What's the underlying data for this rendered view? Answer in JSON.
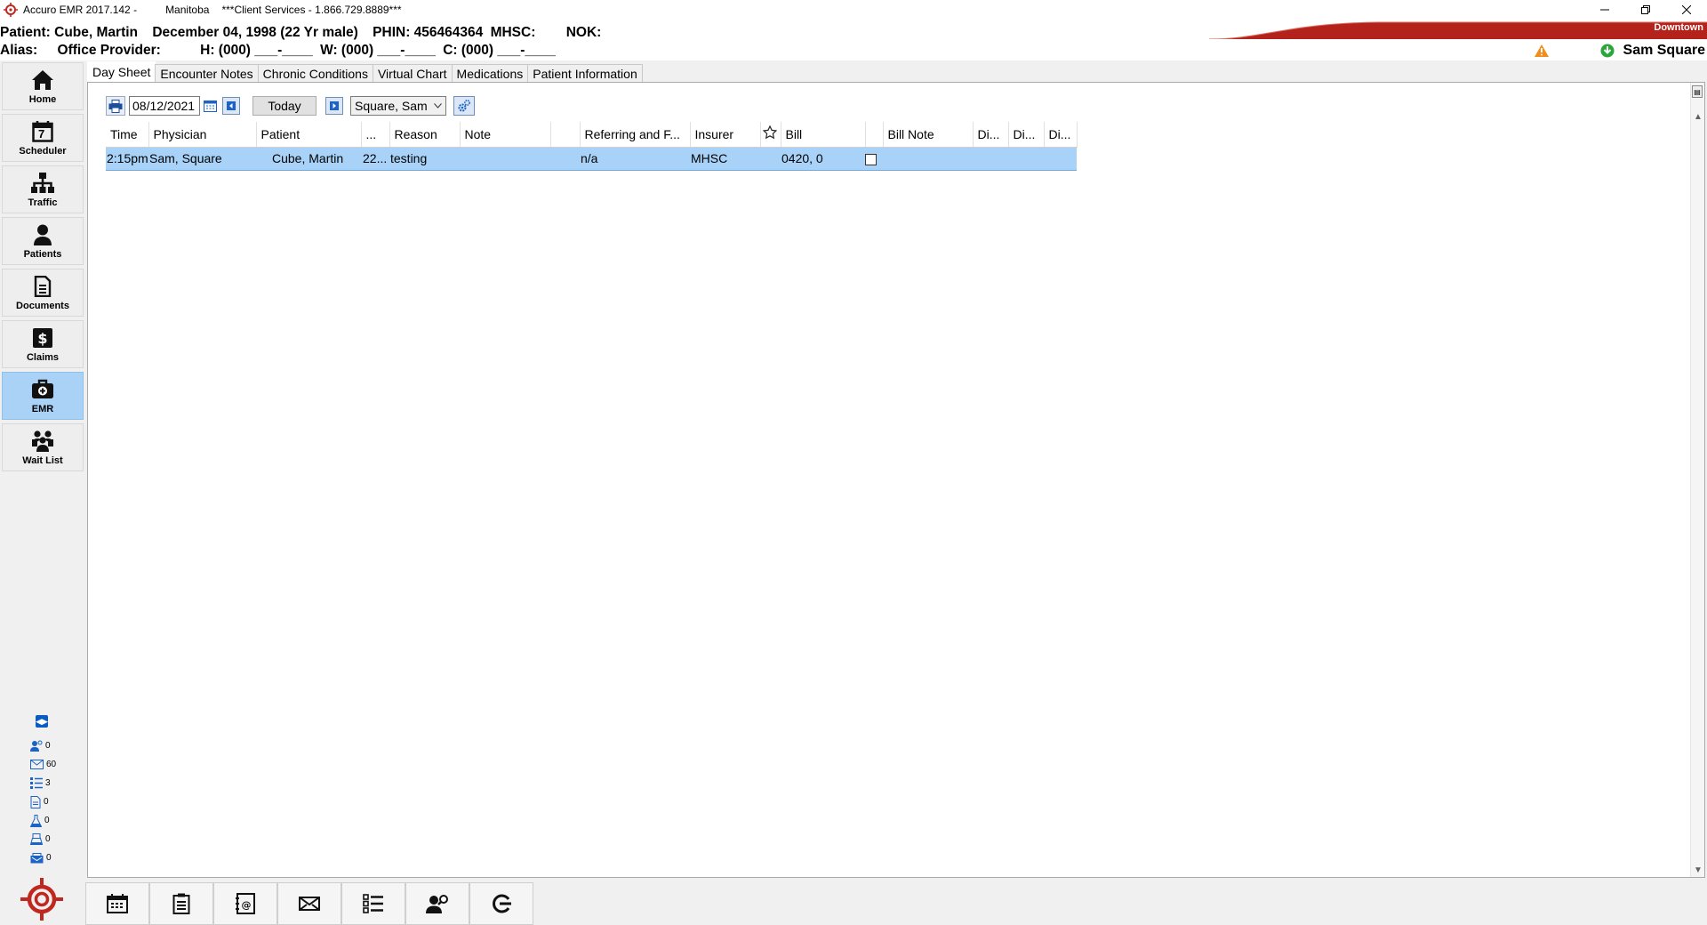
{
  "titlebar": {
    "app_title": "Accuro EMR 2017.142 -",
    "province": "Manitoba",
    "client_services": "***Client Services - 1.866.729.8889***"
  },
  "patient": {
    "line1": {
      "name": "Patient: Cube, Martin",
      "dob": "December 04, 1998 (22 Yr  male)",
      "phin": "PHIN:  456464364",
      "mhsc": "MHSC:",
      "nok": "NOK:"
    },
    "line2": {
      "alias": "Alias:",
      "office_provider": "Office Provider:",
      "home_phone": "H: (000) ___-____",
      "work_phone": "W: (000) ___-____",
      "cell_phone": "C: (000) ___-____"
    }
  },
  "header_right": {
    "location": "Downtown",
    "user": "Sam Square",
    "colors": {
      "brand_red": "#b3231c",
      "warning": "#f28c1a",
      "ok": "#2aa63a"
    }
  },
  "sidebar": {
    "items": [
      {
        "label": "Home",
        "icon": "home-icon"
      },
      {
        "label": "Scheduler",
        "icon": "calendar-icon"
      },
      {
        "label": "Traffic",
        "icon": "org-chart-icon"
      },
      {
        "label": "Patients",
        "icon": "person-icon"
      },
      {
        "label": "Documents",
        "icon": "document-icon"
      },
      {
        "label": "Claims",
        "icon": "dollar-icon"
      },
      {
        "label": "EMR",
        "icon": "medical-bag-icon",
        "active": true
      },
      {
        "label": "Wait List",
        "icon": "people-group-icon"
      }
    ],
    "calendar_day": "7",
    "counters": [
      {
        "icon": "patient-icon",
        "value": "0"
      },
      {
        "icon": "mail-icon",
        "value": "60"
      },
      {
        "icon": "list-icon",
        "value": "3"
      },
      {
        "icon": "document-icon",
        "value": "0"
      },
      {
        "icon": "lab-flask-icon",
        "value": "0"
      },
      {
        "icon": "printer-icon",
        "value": "0"
      },
      {
        "icon": "fax-icon",
        "value": "0"
      }
    ]
  },
  "tabs": [
    "Day Sheet",
    "Encounter Notes",
    "Chronic Conditions",
    "Virtual Chart",
    "Medications",
    "Patient Information"
  ],
  "toolbar": {
    "date": "08/12/2021",
    "today_label": "Today",
    "physician": "Square, Sam"
  },
  "grid": {
    "columns": [
      "Time",
      "Physician",
      "Patient",
      "...",
      "Reason",
      "Note",
      "",
      "Referring and F...",
      "Insurer",
      "",
      "Bill",
      "",
      "Bill Note",
      "Di...",
      "Di...",
      "Di..."
    ],
    "rows": [
      [
        "2:15pm",
        "Sam, Square",
        "Cube, Martin",
        "22...",
        "testing",
        "",
        "",
        "n/a",
        "MHSC",
        "",
        "0420, 0",
        "",
        "",
        "",
        "",
        ""
      ]
    ]
  }
}
